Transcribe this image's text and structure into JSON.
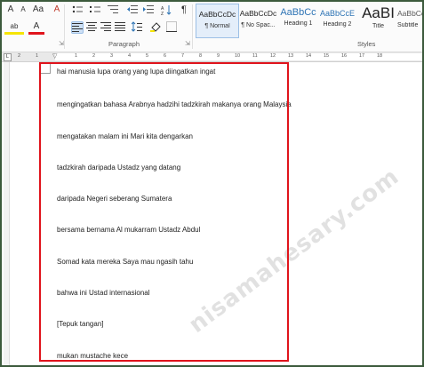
{
  "ribbon": {
    "font": {
      "grow_label": "A",
      "shrink_label": "A",
      "case_label": "Aa",
      "clear_label": "A",
      "highlight_label": "ab",
      "color_label": "A",
      "paragraph_mark": "¶"
    },
    "group_label": "Paragraph",
    "styles_group_label": "Styles",
    "styles": [
      {
        "preview": "AaBbCcDc",
        "name": "¶ Normal",
        "preview_color": "#222222"
      },
      {
        "preview": "AaBbCcDc",
        "name": "¶ No Spac...",
        "preview_color": "#222222"
      },
      {
        "preview": "AaBbCc",
        "name": "Heading 1",
        "preview_color": "#2e74b5"
      },
      {
        "preview": "AaBbCcE",
        "name": "Heading 2",
        "preview_color": "#2e74b5"
      },
      {
        "preview": "AaBI",
        "name": "Title",
        "preview_color": "#222222"
      },
      {
        "preview": "AaBbCcD",
        "name": "Subtitle",
        "preview_color": "#5a5a5a"
      }
    ]
  },
  "ruler": {
    "numbers": [
      "2",
      "1",
      "1",
      "2",
      "3",
      "4",
      "5",
      "6",
      "7",
      "8",
      "9",
      "10",
      "11",
      "12",
      "13",
      "14",
      "15",
      "16",
      "17",
      "18"
    ]
  },
  "document": {
    "paragraphs": [
      "hai manusia lupa orang yang lupa diingatkan ingat",
      "mengingatkan bahasa Arabnya hadzihi tadzkirah makanya orang Malaysia",
      "mengatakan malam ini Mari kita dengarkan",
      "tadzkirah daripada Ustadz yang datang",
      "daripada Negeri seberang Sumatera",
      "bersama bernama Al mukarram Ustadz Abdul",
      "Somad kata mereka Saya mau ngasih tahu",
      "bahwa ini Ustad internasional",
      "[Tepuk tangan]",
      "mukan mustache kece"
    ],
    "watermark": "nisamahesary.com"
  },
  "colors": {
    "selection_border": "#e0141c",
    "heading": "#2e74b5"
  }
}
